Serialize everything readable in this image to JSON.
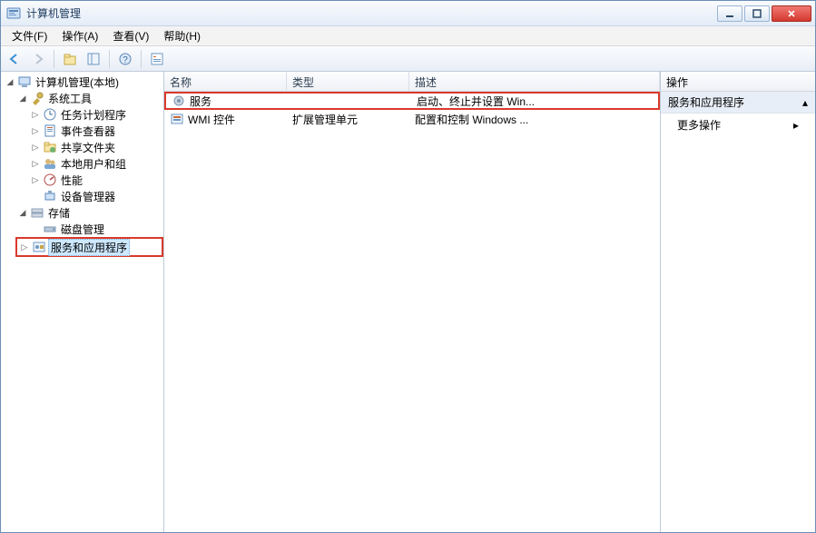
{
  "window": {
    "title": "计算机管理"
  },
  "menu": {
    "file": "文件(F)",
    "action": "操作(A)",
    "view": "查看(V)",
    "help": "帮助(H)"
  },
  "tree": {
    "root": "计算机管理(本地)",
    "sys_tools": "系统工具",
    "task_scheduler": "任务计划程序",
    "event_viewer": "事件查看器",
    "shared_folders": "共享文件夹",
    "local_users": "本地用户和组",
    "performance": "性能",
    "device_manager": "设备管理器",
    "storage": "存储",
    "disk_mgmt": "磁盘管理",
    "services_apps": "服务和应用程序"
  },
  "list": {
    "col_name": "名称",
    "col_type": "类型",
    "col_desc": "描述",
    "rows": [
      {
        "name": "服务",
        "type": "",
        "desc": "启动、终止并设置 Win..."
      },
      {
        "name": "WMI 控件",
        "type": "扩展管理单元",
        "desc": "配置和控制 Windows ..."
      }
    ]
  },
  "actions": {
    "header": "操作",
    "group": "服务和应用程序",
    "more": "更多操作"
  }
}
